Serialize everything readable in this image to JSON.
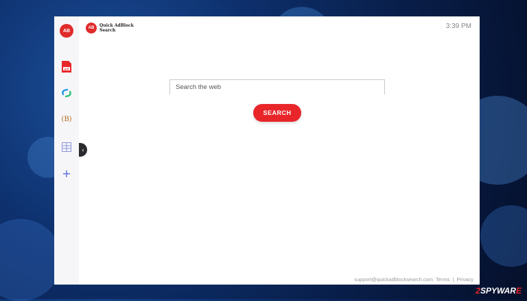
{
  "brand": {
    "logo_text": "AB",
    "name_line1": "Quick AdBlock",
    "name_line2": "Search"
  },
  "clock": "3:39 PM",
  "sidebar": {
    "logo_text": "AB",
    "items": [
      {
        "name": "pdf-icon",
        "label": "pdf"
      },
      {
        "name": "link-icon"
      },
      {
        "name": "bitcoin-icon",
        "label": "(B)"
      },
      {
        "name": "calculator-icon"
      },
      {
        "name": "plus-icon"
      }
    ],
    "collapse_icon": "‹"
  },
  "search": {
    "placeholder": "Search the web",
    "button_label": "SEARCH"
  },
  "footer": {
    "email": "support@quickadblocksearch.com",
    "terms": "Terms",
    "separator": "|",
    "privacy": "Privacy"
  },
  "watermark": {
    "prefix": "2",
    "main": "SPYWAR",
    "suffix": "E"
  },
  "colors": {
    "accent": "#e8262a",
    "desktop": "#0d2f6b"
  }
}
